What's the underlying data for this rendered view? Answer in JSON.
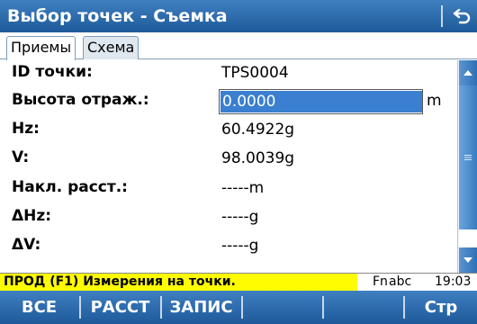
{
  "window": {
    "title": "Выбор точек - Съемка",
    "back_icon": "return-arrow-icon"
  },
  "tabs": [
    {
      "label": "Приемы",
      "active": true
    },
    {
      "label": "Схема",
      "active": false
    }
  ],
  "fields": [
    {
      "label": "ID точки:",
      "value": "TPS0004"
    },
    {
      "label": "Высота отраж.:",
      "value": "0.0000",
      "unit": "m",
      "editable": true
    },
    {
      "label": "Hz:",
      "value": "60.4922g"
    },
    {
      "label": "V:",
      "value": "98.0039g"
    },
    {
      "label": "Накл. расст.:",
      "value": "-----m"
    },
    {
      "label": "ΔHz:",
      "value": "-----g"
    },
    {
      "label": "ΔV:",
      "value": "-----g"
    }
  ],
  "status": {
    "message": "ПРОД (F1) Измерения на точки.",
    "mode": "Fn",
    "input_case": "abc",
    "time": "19:03"
  },
  "softkeys": [
    "ВСЕ",
    "РАССТ",
    "ЗАПИС",
    "",
    "",
    "Стр"
  ],
  "colors": {
    "titlebar": "#2f6fb5",
    "selection": "#3a7fd0",
    "status_highlight": "#fffc00"
  }
}
